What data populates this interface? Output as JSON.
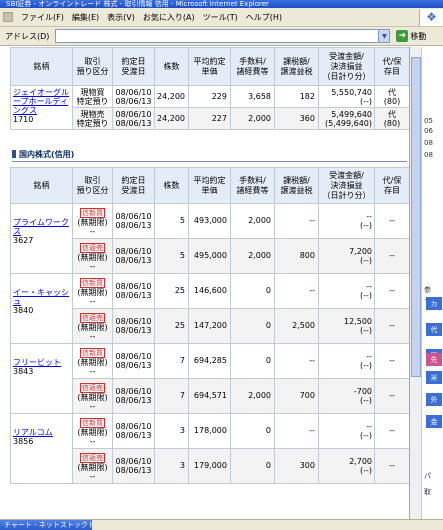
{
  "window": {
    "title": "SBI証券 - オンライントレード 株式 - 取引情報 信用 - Microsoft Internet Explorer"
  },
  "menu": {
    "items": [
      "ファイル(F)",
      "編集(E)",
      "表示(V)",
      "お気に入り(A)",
      "ツール(T)",
      "ヘルプ(H)"
    ]
  },
  "address": {
    "label": "アドレス(D)",
    "value": "",
    "go_label": "移動"
  },
  "table_top": {
    "headers": [
      "銘柄",
      "取引\n預り区分",
      "約定日\n受渡日",
      "株数",
      "平均約定\n単価",
      "手数料/\n諸経費等",
      "課税額/\n譲渡益税",
      "受渡金額/\n決済損益\n（日計り分）",
      "代/保\n存目"
    ],
    "rows": [
      {
        "name": "ジェイオーグループホールディングス",
        "code": "1710",
        "kubun": "現物買\n特定預り",
        "dates": "08/06/10\n08/06/13",
        "qty": "24,200",
        "price": "229",
        "fee": "3,658",
        "tax": "182",
        "settle1": "5,550,740",
        "settle2": "(--)",
        "last": "代\n(80)"
      },
      {
        "name": "",
        "code": "",
        "kubun": "現物売\n特定預り",
        "dates": "08/06/10\n08/06/13",
        "qty": "24,200",
        "price": "227",
        "fee": "2,000",
        "tax": "360",
        "settle1": "5,499,640",
        "settle2": "(5,499,640)",
        "last": "代\n(80)"
      }
    ]
  },
  "section_margin": {
    "title": "国内株式(信用)",
    "headers": [
      "銘柄",
      "取引\n預り区分",
      "約定日\n受渡日",
      "株数",
      "平均約定\n単価",
      "手数料/\n諸経費等",
      "課税額/\n譲渡益税",
      "受渡金額/\n決済損益\n（日計り分）",
      "代/保\n存目"
    ],
    "stocks": [
      {
        "name": "プライムワークス",
        "code": "3627",
        "rows": [
          {
            "badge": "信新買",
            "sub": "(無期限)",
            "tail": "--",
            "dates": "08/06/10\n08/06/13",
            "qty": "5",
            "price": "493,000",
            "fee": "2,000",
            "tax": "--",
            "settle1": "--",
            "settle2": "(--)",
            "last": "--"
          },
          {
            "badge": "信返売",
            "sub": "(無期限)",
            "tail": "--",
            "dates": "08/06/10\n08/06/13",
            "qty": "5",
            "price": "495,000",
            "fee": "2,000",
            "tax": "800",
            "settle1": "7,200",
            "settle2": "(--)",
            "last": "--"
          }
        ]
      },
      {
        "name": "イー・キャッシュ",
        "code": "3840",
        "rows": [
          {
            "badge": "信新買",
            "sub": "(無期限)",
            "tail": "--",
            "dates": "08/06/10\n08/06/13",
            "qty": "25",
            "price": "146,600",
            "fee": "0",
            "tax": "--",
            "settle1": "--",
            "settle2": "(--)",
            "last": "--"
          },
          {
            "badge": "信返売",
            "sub": "(無期限)",
            "tail": "--",
            "dates": "08/06/10\n08/06/13",
            "qty": "25",
            "price": "147,200",
            "fee": "0",
            "tax": "2,500",
            "settle1": "12,500",
            "settle2": "(--)",
            "last": "--"
          }
        ]
      },
      {
        "name": "フリービット",
        "code": "3843",
        "rows": [
          {
            "badge": "信新買",
            "sub": "(無期限)",
            "tail": "--",
            "dates": "08/06/10\n08/06/13",
            "qty": "7",
            "price": "694,285",
            "fee": "0",
            "tax": "--",
            "settle1": "--",
            "settle2": "(--)",
            "last": "--"
          },
          {
            "badge": "信返売",
            "sub": "(無期限)",
            "tail": "--",
            "dates": "08/06/10\n08/06/13",
            "qty": "7",
            "price": "694,571",
            "fee": "2,000",
            "tax": "700",
            "settle1": "-700",
            "settle2": "(--)",
            "last": "--"
          }
        ]
      },
      {
        "name": "リアルコム",
        "code": "3856",
        "rows": [
          {
            "badge": "信新買",
            "sub": "(無期限)",
            "tail": "--",
            "dates": "08/06/10\n08/06/13",
            "qty": "3",
            "price": "178,000",
            "fee": "0",
            "tax": "--",
            "settle1": "--",
            "settle2": "(--)",
            "last": "--"
          },
          {
            "badge": "信返売",
            "sub": "(無期限)",
            "tail": "--",
            "dates": "08/06/10\n08/06/13",
            "qty": "3",
            "price": "179,000",
            "fee": "0",
            "tax": "300",
            "settle1": "2,700",
            "settle2": "(--)",
            "last": "--"
          }
        ]
      }
    ]
  },
  "right_panel": {
    "texts": [
      "05",
      "06",
      "08",
      "08",
      "参",
      "す",
      "パ",
      "取"
    ],
    "tags": [
      {
        "label": "カ",
        "color": "#3a6fd8"
      },
      {
        "label": "代",
        "color": "#3a6fd8"
      },
      {
        "label": "現",
        "color": "#3a6fd8"
      },
      {
        "label": "先",
        "color": "#d05090"
      },
      {
        "label": "米",
        "color": "#3a6fd8"
      },
      {
        "label": "外",
        "color": "#3a6fd8"
      },
      {
        "label": "金",
        "color": "#3a6fd8"
      }
    ]
  },
  "taskbar": {
    "label": "チャート - ネットストックトレ..."
  }
}
